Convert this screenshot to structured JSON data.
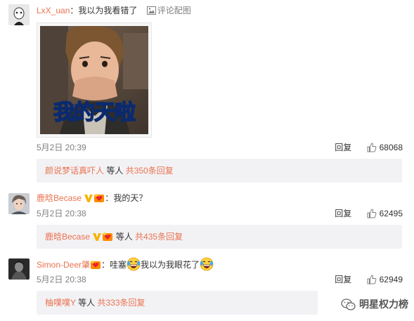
{
  "comments": [
    {
      "user": "LxX_uan",
      "text": "：我以为我看错了",
      "extra_link": "评论配图",
      "sticker_text": "我的天啦",
      "time": "5月2日 20:39",
      "reply_label": "回复",
      "likes": "68068",
      "sub": {
        "user": "颜说梦话真吓人",
        "mid": " 等人 ",
        "count": "共350条回复"
      }
    },
    {
      "user": "鹿晗Becase",
      "text": "：我的天？",
      "time": "5月2日 20:38",
      "reply_label": "回复",
      "likes": "62495",
      "sub": {
        "user": "鹿晗Becase",
        "mid": " 等人 ",
        "count": "共435条回复"
      }
    },
    {
      "user": "Simon-Deer肇",
      "text_a": "：哇塞",
      "text_b": "我以为我眼花了",
      "time": "5月2日 20:38",
      "reply_label": "回复",
      "likes": "62949",
      "sub": {
        "user": "柚噗噗Y",
        "mid": " 等人 ",
        "count": "共333条回复"
      }
    }
  ],
  "watermark": "明星权力榜",
  "colors": {
    "username": "#eb7350",
    "meta": "#808080",
    "subbox_bg": "#f2f2f5",
    "verified_v": "#f5b400"
  },
  "icons": [
    "image-icon",
    "thumb-up-icon",
    "verified-v-icon",
    "love-badge-icon",
    "laugh-cry-emoji",
    "wechat-icon"
  ]
}
